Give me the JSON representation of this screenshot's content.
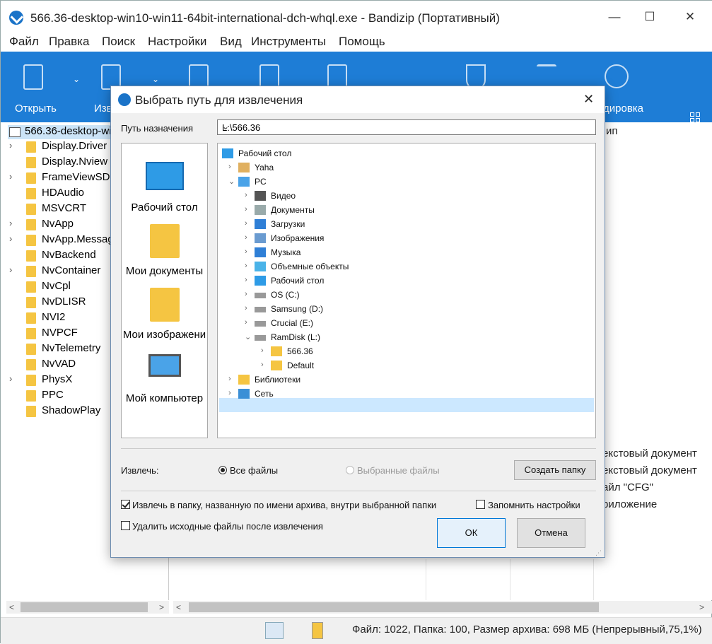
{
  "window": {
    "title": "566.36-desktop-win10-win11-64bit-international-dch-whql.exe - Bandizip (Портативный)",
    "minimize": "—",
    "maximize": "☐",
    "close": "✕"
  },
  "menu": [
    "Файл",
    "Правка",
    "Поиск",
    "Настройки",
    "Вид",
    "Инструменты",
    "Помощь"
  ],
  "toolbar": {
    "open_label": "Открыть",
    "extract_label": "Изв",
    "edit_label": "дировка"
  },
  "left_tree": {
    "root": "566.36-desktop-wi",
    "items": [
      {
        "label": "Display.Driver",
        "expandable": true
      },
      {
        "label": "Display.Nview",
        "expandable": false
      },
      {
        "label": "FrameViewSDK",
        "expandable": true
      },
      {
        "label": "HDAudio",
        "expandable": false
      },
      {
        "label": "MSVCRT",
        "expandable": false
      },
      {
        "label": "NvApp",
        "expandable": true
      },
      {
        "label": "NvApp.Messag",
        "expandable": true
      },
      {
        "label": "NvBackend",
        "expandable": false
      },
      {
        "label": "NvContainer",
        "expandable": true
      },
      {
        "label": "NvCpl",
        "expandable": false
      },
      {
        "label": "NvDLISR",
        "expandable": false
      },
      {
        "label": "NVI2",
        "expandable": false
      },
      {
        "label": "NVPCF",
        "expandable": false
      },
      {
        "label": "NvTelemetry",
        "expandable": false
      },
      {
        "label": "NvVAD",
        "expandable": false
      },
      {
        "label": "PhysX",
        "expandable": true
      },
      {
        "label": "PPC",
        "expandable": false
      },
      {
        "label": "ShadowPlay",
        "expandable": false
      }
    ]
  },
  "right_pane": {
    "header_partial": "ип",
    "types": [
      "екстовый документ",
      "екстовый документ",
      "айл \"CFG\"",
      "риложение"
    ]
  },
  "status": {
    "text": "Файл: 1022, Папка: 100, Размер архива: 698 МБ (Непрерывный,75,1%)"
  },
  "dialog": {
    "title": "Выбрать путь для извлечения",
    "close": "✕",
    "dest_label": "Путь назначения",
    "dest_value": "L:\\566.36",
    "places": [
      "Рабочий стол",
      "Мои документы",
      "Мои изображени",
      "Мой компьютер"
    ],
    "tree": [
      {
        "label": "Рабочий стол",
        "indent": 0,
        "chev": "",
        "icon": "desktop-icon"
      },
      {
        "label": "Yaha",
        "indent": 1,
        "chev": ">",
        "icon": "user-icon"
      },
      {
        "label": "PC",
        "indent": 1,
        "chev": "v",
        "icon": "pc-icon"
      },
      {
        "label": "Видео",
        "indent": 2,
        "chev": ">",
        "icon": "video-icon"
      },
      {
        "label": "Документы",
        "indent": 2,
        "chev": ">",
        "icon": "documents-icon"
      },
      {
        "label": "Загрузки",
        "indent": 2,
        "chev": ">",
        "icon": "downloads-icon"
      },
      {
        "label": "Изображения",
        "indent": 2,
        "chev": ">",
        "icon": "pictures-icon"
      },
      {
        "label": "Музыка",
        "indent": 2,
        "chev": ">",
        "icon": "music-icon"
      },
      {
        "label": "Объемные объекты",
        "indent": 2,
        "chev": ">",
        "icon": "3d-objects-icon"
      },
      {
        "label": "Рабочий стол",
        "indent": 2,
        "chev": ">",
        "icon": "desktop-icon"
      },
      {
        "label": "OS (C:)",
        "indent": 2,
        "chev": ">",
        "icon": "drive-icon"
      },
      {
        "label": "Samsung (D:)",
        "indent": 2,
        "chev": ">",
        "icon": "drive-icon"
      },
      {
        "label": "Crucial (E:)",
        "indent": 2,
        "chev": ">",
        "icon": "drive-icon"
      },
      {
        "label": "RamDisk (L:)",
        "indent": 2,
        "chev": "v",
        "icon": "drive-icon"
      },
      {
        "label": "566.36",
        "indent": 3,
        "chev": ">",
        "icon": "folder-icon",
        "selected": true
      },
      {
        "label": "Default",
        "indent": 3,
        "chev": ">",
        "icon": "folder-icon"
      },
      {
        "label": "Библиотеки",
        "indent": 1,
        "chev": ">",
        "icon": "libraries-icon"
      },
      {
        "label": "Сеть",
        "indent": 1,
        "chev": ">",
        "icon": "network-icon"
      }
    ],
    "extract_label": "Извлечь:",
    "radio_all": "Все файлы",
    "radio_selected": "Выбранные файлы",
    "create_folder": "Создать папку",
    "chk_subfolder": "Извлечь в папку, названную по имени архива, внутри выбранной папки",
    "chk_remember": "Запомнить настройки",
    "chk_delete": "Удалить исходные файлы после извлечения",
    "ok": "ОК",
    "cancel": "Отмена"
  }
}
